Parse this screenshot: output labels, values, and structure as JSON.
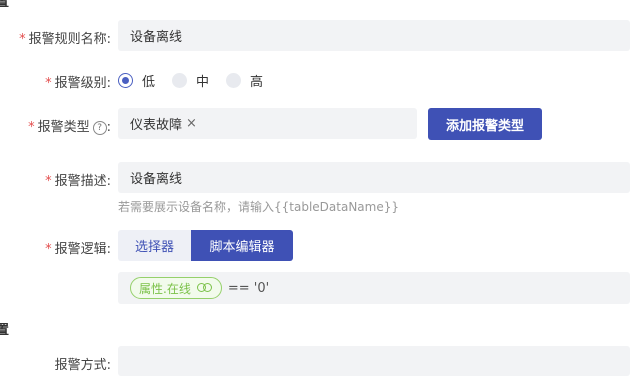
{
  "sections": {
    "top_char": "置",
    "mid_char": "置"
  },
  "rule_name": {
    "required": "*",
    "label": "报警规则名称:",
    "value": "设备离线"
  },
  "level": {
    "required": "*",
    "label": "报警级别:",
    "options": [
      {
        "label": "低",
        "checked": true
      },
      {
        "label": "中",
        "checked": false
      },
      {
        "label": "高",
        "checked": false
      }
    ]
  },
  "alarm_type": {
    "required": "*",
    "label": "报警类型",
    "help_icon": "question-circle-icon",
    "colon": ":",
    "tag": "仪表故障",
    "tag_close": "×",
    "add_button": "添加报警类型"
  },
  "description": {
    "required": "*",
    "label": "报警描述:",
    "value": "设备离线",
    "hint": "若需要展示设备名称，请输入{{tableDataName}}"
  },
  "logic": {
    "required": "*",
    "label": "报警逻辑:",
    "tabs": [
      {
        "label": "选择器",
        "active": false
      },
      {
        "label": "脚本编辑器",
        "active": true
      }
    ],
    "expression_pill": "属性.在线",
    "expression_rest": "== '0'"
  },
  "method": {
    "label": "报警方式:"
  },
  "colors": {
    "primary": "#3f51b5",
    "required": "#e34d4d",
    "pill_green": "#7cc24a"
  }
}
